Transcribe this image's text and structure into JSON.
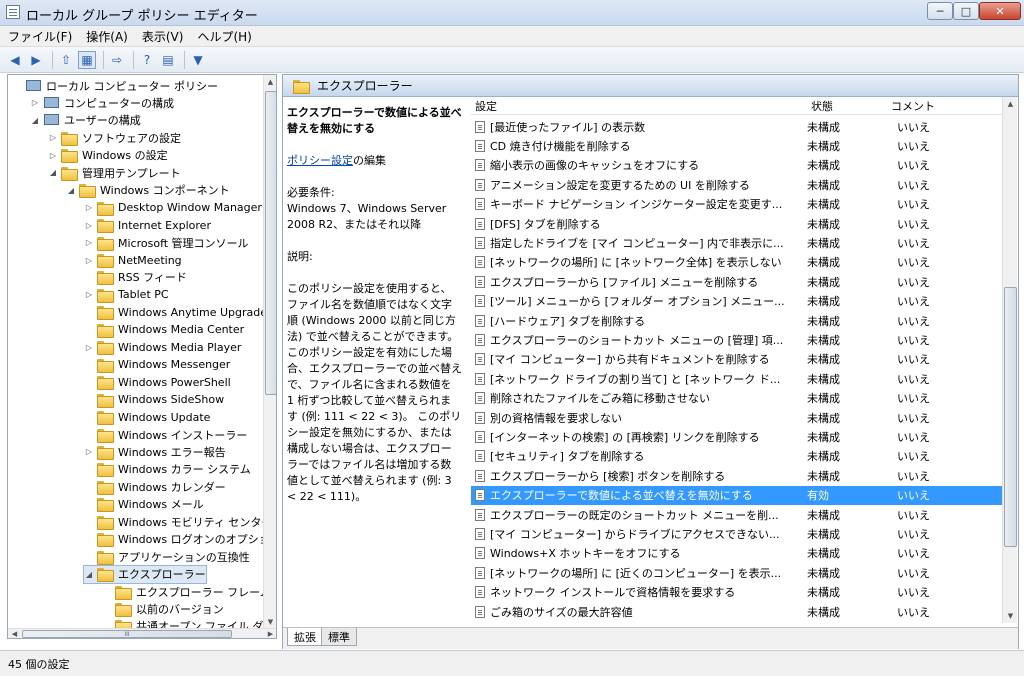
{
  "window": {
    "title": "ローカル グループ ポリシー エディター",
    "min": "─",
    "max": "□",
    "close": "✕"
  },
  "menu": [
    "ファイル(F)",
    "操作(A)",
    "表示(V)",
    "ヘルプ(H)"
  ],
  "toolbar": {
    "back": "◀",
    "forward": "▶",
    "up": "⇧",
    "show_hide": "▦",
    "export": "⇨",
    "help": "?",
    "properties": "▤",
    "filter": "▼"
  },
  "tree": [
    {
      "label": "ローカル コンピューター ポリシー",
      "level": 0,
      "exp": "",
      "icon": "pc"
    },
    {
      "label": "コンピューターの構成",
      "level": 1,
      "exp": "▷",
      "icon": "pc"
    },
    {
      "label": "ユーザーの構成",
      "level": 1,
      "exp": "◢",
      "icon": "pc"
    },
    {
      "label": "ソフトウェアの設定",
      "level": 2,
      "exp": "▷",
      "icon": "folder"
    },
    {
      "label": "Windows の設定",
      "level": 2,
      "exp": "▷",
      "icon": "folder"
    },
    {
      "label": "管理用テンプレート",
      "level": 2,
      "exp": "◢",
      "icon": "folder"
    },
    {
      "label": "Windows コンポーネント",
      "level": 3,
      "exp": "◢",
      "icon": "folder"
    },
    {
      "label": "Desktop Window Manager",
      "level": 4,
      "exp": "▷",
      "icon": "folder"
    },
    {
      "label": "Internet Explorer",
      "level": 4,
      "exp": "▷",
      "icon": "folder"
    },
    {
      "label": "Microsoft 管理コンソール",
      "level": 4,
      "exp": "▷",
      "icon": "folder"
    },
    {
      "label": "NetMeeting",
      "level": 4,
      "exp": "▷",
      "icon": "folder"
    },
    {
      "label": "RSS フィード",
      "level": 4,
      "exp": "",
      "icon": "folder"
    },
    {
      "label": "Tablet PC",
      "level": 4,
      "exp": "▷",
      "icon": "folder"
    },
    {
      "label": "Windows Anytime Upgrade",
      "level": 4,
      "exp": "",
      "icon": "folder"
    },
    {
      "label": "Windows Media Center",
      "level": 4,
      "exp": "",
      "icon": "folder"
    },
    {
      "label": "Windows Media Player",
      "level": 4,
      "exp": "▷",
      "icon": "folder"
    },
    {
      "label": "Windows Messenger",
      "level": 4,
      "exp": "",
      "icon": "folder"
    },
    {
      "label": "Windows PowerShell",
      "level": 4,
      "exp": "",
      "icon": "folder"
    },
    {
      "label": "Windows SideShow",
      "level": 4,
      "exp": "",
      "icon": "folder"
    },
    {
      "label": "Windows Update",
      "level": 4,
      "exp": "",
      "icon": "folder"
    },
    {
      "label": "Windows インストーラー",
      "level": 4,
      "exp": "",
      "icon": "folder"
    },
    {
      "label": "Windows エラー報告",
      "level": 4,
      "exp": "▷",
      "icon": "folder"
    },
    {
      "label": "Windows カラー システム",
      "level": 4,
      "exp": "",
      "icon": "folder"
    },
    {
      "label": "Windows カレンダー",
      "level": 4,
      "exp": "",
      "icon": "folder"
    },
    {
      "label": "Windows メール",
      "level": 4,
      "exp": "",
      "icon": "folder"
    },
    {
      "label": "Windows モビリティ センター",
      "level": 4,
      "exp": "",
      "icon": "folder"
    },
    {
      "label": "Windows ログオンのオプション",
      "level": 4,
      "exp": "",
      "icon": "folder"
    },
    {
      "label": "アプリケーションの互換性",
      "level": 4,
      "exp": "",
      "icon": "folder"
    },
    {
      "label": "エクスプローラー",
      "level": 4,
      "exp": "◢",
      "icon": "folder",
      "selected": true
    },
    {
      "label": "エクスプローラー フレーム ウ",
      "level": 5,
      "exp": "",
      "icon": "folder"
    },
    {
      "label": "以前のバージョン",
      "level": 5,
      "exp": "",
      "icon": "folder"
    },
    {
      "label": "共通オープン ファイル ダイア",
      "level": 5,
      "exp": "",
      "icon": "folder"
    }
  ],
  "right": {
    "header": "エクスプローラー",
    "desc": {
      "title": "エクスプローラーで数値による並べ替えを無効にする",
      "edit_link": "ポリシー設定",
      "edit_suffix": "の編集",
      "req_label": "必要条件:",
      "req_text": "Windows 7、Windows Server 2008 R2、またはそれ以降",
      "desc_label": "説明:",
      "desc_text": "このポリシー設定を使用すると、ファイル名を数値順ではなく文字順 (Windows 2000 以前と同じ方法) で並べ替えることができます。 このポリシー設定を有効にした場合、エクスプローラーでの並べ替えで、ファイル名に含まれる数値を 1 桁ずつ比較して並べ替えられます (例: 111 < 22 < 3)。 このポリシー設定を無効にするか、または構成しない場合は、エクスプローラーではファイル名は増加する数値として並べ替えられます (例: 3 < 22 < 111)。"
    },
    "columns": {
      "name": "設定",
      "state": "状態",
      "comment": "コメント"
    },
    "rows": [
      {
        "name": "[最近使ったファイル] の表示数",
        "state": "未構成",
        "comment": "いいえ"
      },
      {
        "name": "CD 焼き付け機能を削除する",
        "state": "未構成",
        "comment": "いいえ"
      },
      {
        "name": "縮小表示の画像のキャッシュをオフにする",
        "state": "未構成",
        "comment": "いいえ"
      },
      {
        "name": "アニメーション設定を変更するための UI を削除する",
        "state": "未構成",
        "comment": "いいえ"
      },
      {
        "name": "キーボード ナビゲーション インジケーター設定を変更す...",
        "state": "未構成",
        "comment": "いいえ"
      },
      {
        "name": "[DFS] タブを削除する",
        "state": "未構成",
        "comment": "いいえ"
      },
      {
        "name": "指定したドライブを [マイ コンピューター] 内で非表示に...",
        "state": "未構成",
        "comment": "いいえ"
      },
      {
        "name": "[ネットワークの場所] に [ネットワーク全体] を表示しない",
        "state": "未構成",
        "comment": "いいえ"
      },
      {
        "name": "エクスプローラーから [ファイル] メニューを削除する",
        "state": "未構成",
        "comment": "いいえ"
      },
      {
        "name": "[ツール] メニューから [フォルダー オプション] メニュー...",
        "state": "未構成",
        "comment": "いいえ"
      },
      {
        "name": "[ハードウェア] タブを削除する",
        "state": "未構成",
        "comment": "いいえ"
      },
      {
        "name": "エクスプローラーのショートカット メニューの [管理] 項...",
        "state": "未構成",
        "comment": "いいえ"
      },
      {
        "name": "[マイ コンピューター] から共有ドキュメントを削除する",
        "state": "未構成",
        "comment": "いいえ"
      },
      {
        "name": "[ネットワーク ドライブの割り当て] と [ネットワーク ド...",
        "state": "未構成",
        "comment": "いいえ"
      },
      {
        "name": "削除されたファイルをごみ箱に移動させない",
        "state": "未構成",
        "comment": "いいえ"
      },
      {
        "name": "別の資格情報を要求しない",
        "state": "未構成",
        "comment": "いいえ"
      },
      {
        "name": "[インターネットの検索] の [再検索] リンクを削除する",
        "state": "未構成",
        "comment": "いいえ"
      },
      {
        "name": "[セキュリティ] タブを削除する",
        "state": "未構成",
        "comment": "いいえ"
      },
      {
        "name": "エクスプローラーから [検索] ボタンを削除する",
        "state": "未構成",
        "comment": "いいえ"
      },
      {
        "name": "エクスプローラーで数値による並べ替えを無効にする",
        "state": "有効",
        "comment": "いいえ",
        "selected": true
      },
      {
        "name": "エクスプローラーの既定のショートカット メニューを削...",
        "state": "未構成",
        "comment": "いいえ"
      },
      {
        "name": "[マイ コンピューター] からドライブにアクセスできない...",
        "state": "未構成",
        "comment": "いいえ"
      },
      {
        "name": "Windows+X ホットキーをオフにする",
        "state": "未構成",
        "comment": "いいえ"
      },
      {
        "name": "[ネットワークの場所] に [近くのコンピューター] を表示...",
        "state": "未構成",
        "comment": "いいえ"
      },
      {
        "name": "ネットワーク インストールで資格情報を要求する",
        "state": "未構成",
        "comment": "いいえ"
      },
      {
        "name": "ごみ箱のサイズの最大許容値",
        "state": "未構成",
        "comment": "いいえ"
      }
    ],
    "tabs": [
      "拡張",
      "標準"
    ]
  },
  "scroll": {
    "up": "▲",
    "down": "▼",
    "left": "◀",
    "right": "▶",
    "grip": "III"
  },
  "status": "45 個の設定",
  "colors": {
    "selection": "#3399ff",
    "link": "#0645ad"
  }
}
